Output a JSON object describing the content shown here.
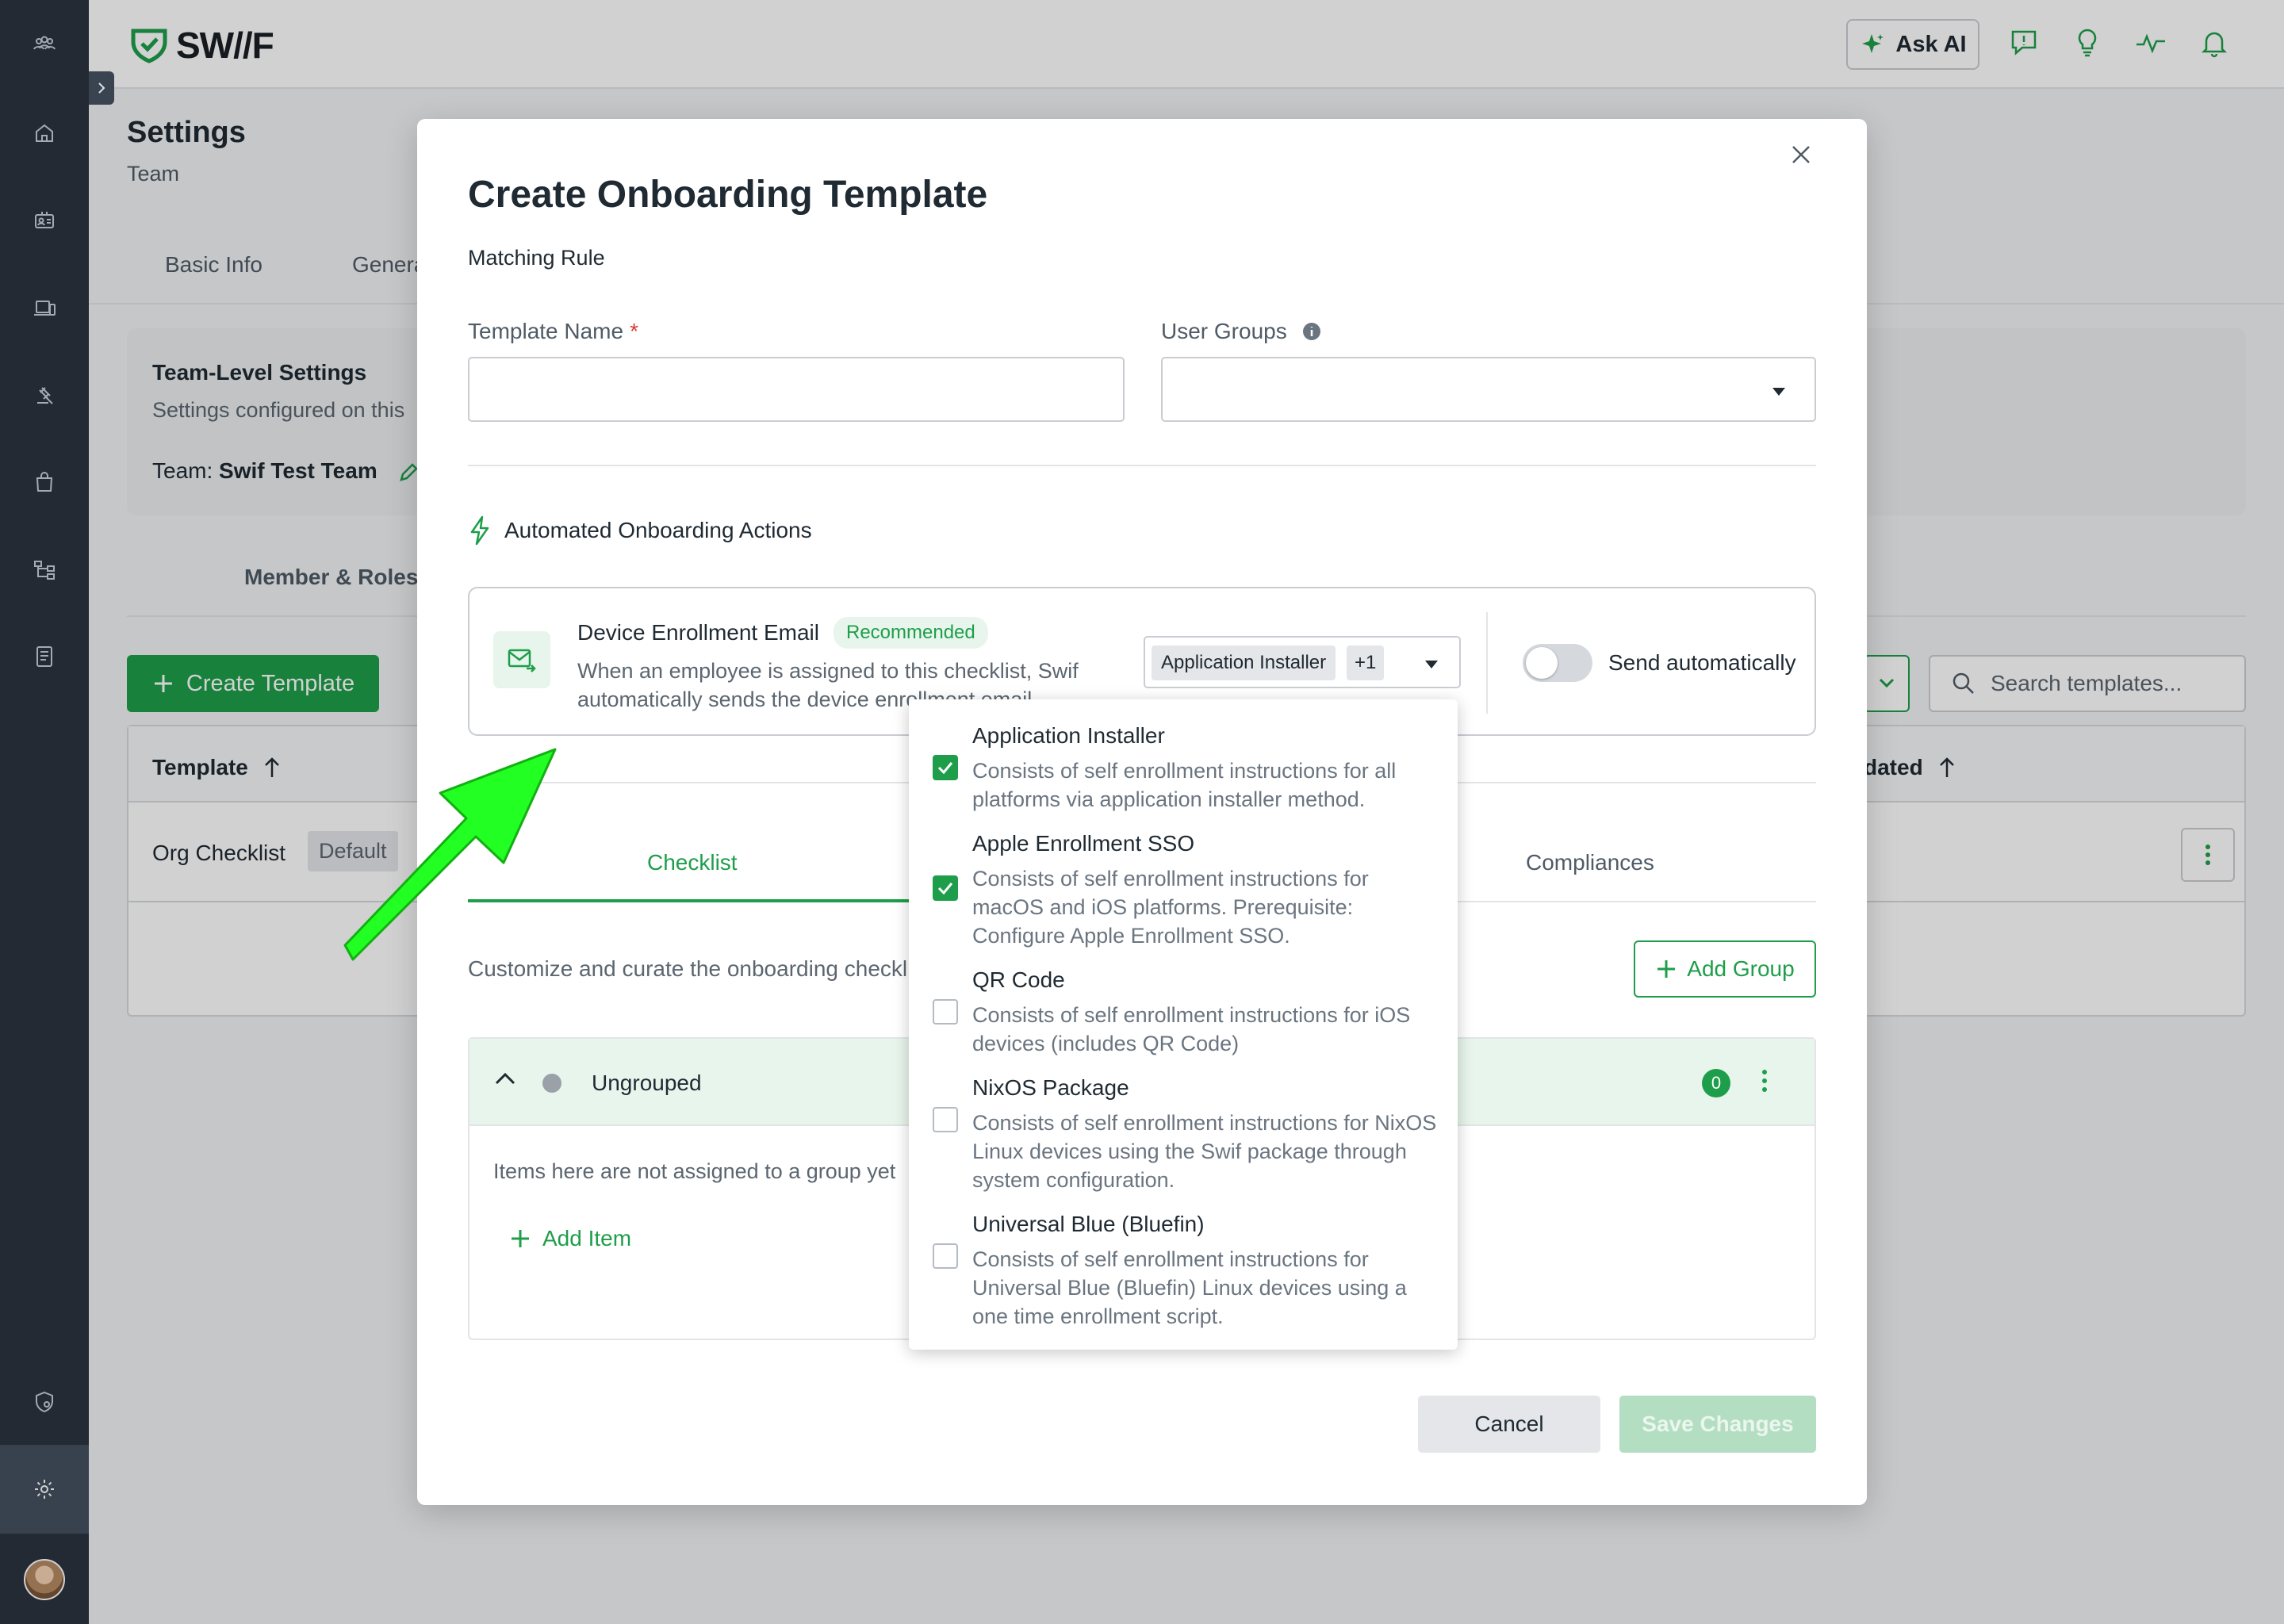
{
  "app": {
    "logo_text": "SW//F",
    "accent_color": "#1e9e4a",
    "sidebar_items": [
      {
        "name": "team-switcher-icon"
      },
      {
        "name": "home-icon"
      },
      {
        "name": "users-icon"
      },
      {
        "name": "devices-icon"
      },
      {
        "name": "policies-icon"
      },
      {
        "name": "apps-icon"
      },
      {
        "name": "workflows-icon"
      },
      {
        "name": "reports-icon"
      },
      {
        "name": "security-icon"
      },
      {
        "name": "settings-icon",
        "active": true
      }
    ]
  },
  "topbar": {
    "ask_ai_label": "Ask AI",
    "icons": [
      "feedback-icon",
      "lightbulb-icon",
      "activity-icon",
      "bell-icon"
    ]
  },
  "page": {
    "title": "Settings",
    "subtitle": "Team",
    "tabs": [
      "Basic Info",
      "Genera"
    ],
    "team_card": {
      "title": "Team-Level Settings",
      "description": "Settings configured on this",
      "team_label": "Team:",
      "team_name": "Swif Test Team"
    },
    "member_tab": "Member & Roles",
    "create_template_label": "Create Template",
    "search_placeholder": "Search templates...",
    "table": {
      "col_template": "Template",
      "col_updated": "dated",
      "rows": [
        {
          "name": "Org Checklist",
          "badge": "Default"
        }
      ]
    }
  },
  "modal": {
    "title": "Create Onboarding Template",
    "subtitle": "Matching Rule",
    "template_name_label": "Template Name",
    "required_mark": "*",
    "template_name_value": "",
    "user_groups_label": "User Groups",
    "user_groups_value": "",
    "automated_header": "Automated Onboarding Actions",
    "action": {
      "title": "Device Enrollment Email",
      "badge": "Recommended",
      "description": "When an employee is assigned to this checklist, Swif automatically sends the device enrollment email",
      "selected_chip": "Application Installer",
      "extra_count": "+1",
      "toggle_label": "Send automatically",
      "toggle_on": false
    },
    "tabs": [
      "Checklist",
      "Compliances"
    ],
    "active_tab": "Checklist",
    "checklist_desc": "Customize and curate the onboarding checkl",
    "add_group_label": "Add Group",
    "group": {
      "name": "Ungrouped",
      "count": "0",
      "empty_text": "Items here are not assigned to a group yet",
      "add_item_label": "Add Item"
    },
    "cancel_label": "Cancel",
    "save_label": "Save Changes"
  },
  "dropdown": {
    "options": [
      {
        "title": "Application Installer",
        "description": "Consists of self enrollment instructions for all platforms via application installer method.",
        "checked": true
      },
      {
        "title": "Apple Enrollment SSO",
        "description": "Consists of self enrollment instructions for macOS and iOS platforms. Prerequisite: Configure Apple Enrollment SSO.",
        "checked": true
      },
      {
        "title": "QR Code",
        "description": "Consists of self enrollment instructions for iOS devices (includes QR Code)",
        "checked": false
      },
      {
        "title": "NixOS Package",
        "description": "Consists of self enrollment instructions for NixOS Linux devices using the Swif package through system configuration.",
        "checked": false
      },
      {
        "title": "Universal Blue (Bluefin)",
        "description": "Consists of self enrollment instructions for Universal Blue (Bluefin) Linux devices using a one time enrollment script.",
        "checked": false
      }
    ]
  },
  "annotation": {
    "color": "#22ff22"
  }
}
